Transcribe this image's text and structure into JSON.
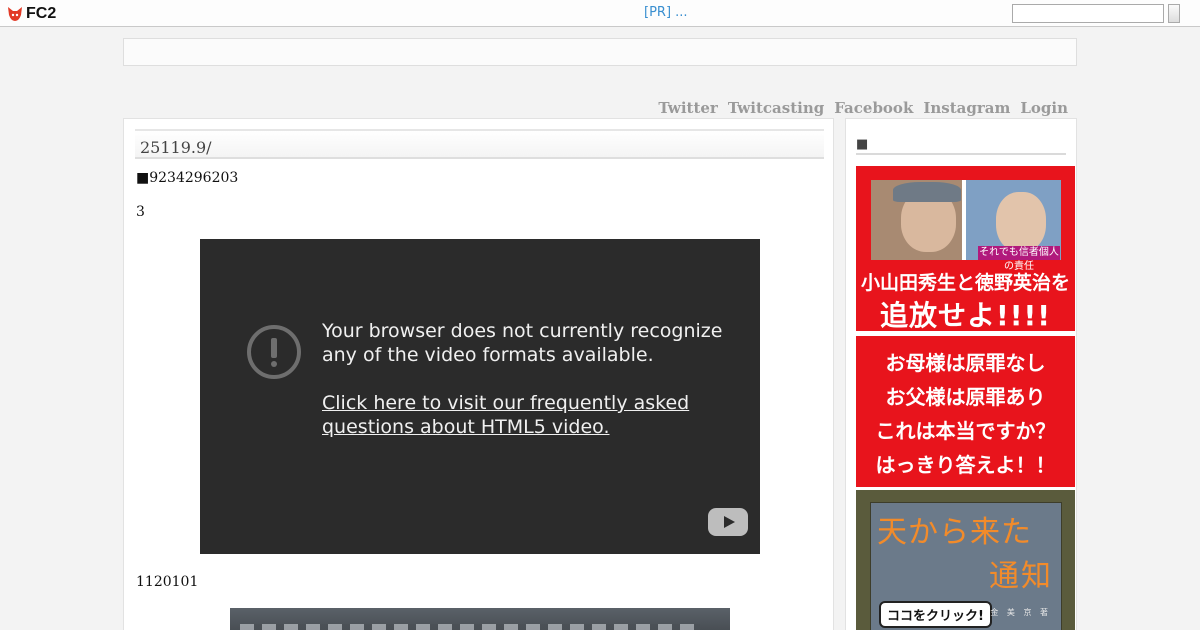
{
  "topbar": {
    "logo_text": "FC2",
    "pr_link": "[PR] ...",
    "search_value": ""
  },
  "nav": {
    "items": [
      "Twitter",
      "Twitcasting",
      "Facebook",
      "Instagram",
      "Login"
    ]
  },
  "entry": {
    "title": "25119.9/",
    "line1": "■9234296203",
    "line2": "3",
    "line3": "1120101"
  },
  "video": {
    "message": "Your browser does not currently recognize any of the video formats available.",
    "link_text": "Click here to visit our frequently asked questions about HTML5 video.",
    "logo_icon": "youtube-icon"
  },
  "sidebar": {
    "heading": "■",
    "banner1": {
      "caption": "それでも信者個人の責任",
      "names": "小山田秀生と徳野英治を",
      "main": "追放せよ!!!!"
    },
    "banner2": {
      "lines": [
        "お母様は原罪なし",
        "お父様は原罪あり",
        "これは本当ですか？",
        "はっきり答えよ！！"
      ]
    },
    "banner3": {
      "title1": "天から来た",
      "title2": "通知",
      "click_label": "ココをクリック!",
      "author": "金 美 京 著"
    }
  },
  "colors": {
    "banner_red": "#e8141c",
    "link_blue": "#3a8fd0",
    "video_bg": "#2b2b2b"
  }
}
